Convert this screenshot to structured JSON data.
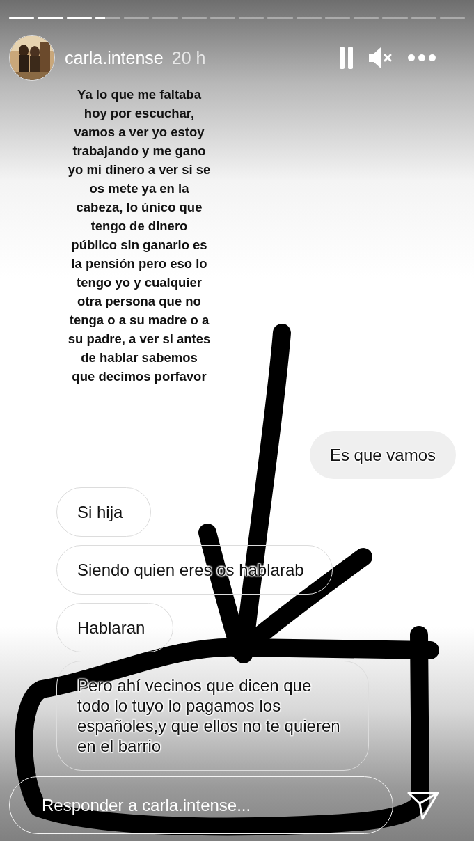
{
  "user": {
    "name": "carla.intense",
    "time": "20 h"
  },
  "story_text": "Ya lo que me faltaba\nhoy por escuchar,\nvamos a ver yo estoy\ntrabajando y me gano\nyo mi dinero a ver si se\nos mete ya en la\ncabeza, lo único que\ntengo de dinero\npúblico sin ganarlo es\nla pensión pero eso lo\ntengo yo y cualquier\notra persona que no\ntenga o a su madre o a\nsu padre, a ver si antes\nde hablar sabemos\nque decimos porfavor",
  "messages": [
    {
      "kind": "sent",
      "text": "Es que vamos"
    },
    {
      "kind": "received",
      "text": "Si hija"
    },
    {
      "kind": "received",
      "text": "Siendo quien eres os hablarab"
    },
    {
      "kind": "received",
      "text": "Hablaran"
    },
    {
      "kind": "received",
      "text": "Pero ahí vecinos que dicen que\ntodo lo tuyo lo pagamos los\nespañoles,y que ellos no te quieren\nen el barrio"
    }
  ],
  "reply": {
    "placeholder": "Responder a carla.intense..."
  }
}
